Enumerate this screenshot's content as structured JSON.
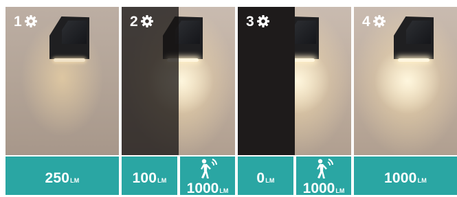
{
  "panels": [
    {
      "number": "1",
      "icon": "gear-icon",
      "mode": "constant dim light"
    },
    {
      "number": "2",
      "icon": "gear-icon",
      "mode": "dim with motion brightening"
    },
    {
      "number": "3",
      "icon": "gear-icon",
      "mode": "off with motion light"
    },
    {
      "number": "4",
      "icon": "gear-icon",
      "mode": "constant bright light"
    }
  ],
  "labels": {
    "l1": {
      "value": "250",
      "unit": "LM"
    },
    "l2a": {
      "value": "100",
      "unit": "LM"
    },
    "l2b": {
      "icon": "motion-sensor-icon",
      "value": "1000",
      "unit": "LM"
    },
    "l3a": {
      "value": "0",
      "unit": "LM"
    },
    "l3b": {
      "icon": "motion-sensor-icon",
      "value": "1000",
      "unit": "LM"
    },
    "l4": {
      "value": "1000",
      "unit": "LM"
    }
  },
  "colors": {
    "accent": "#2aa6a3",
    "text": "#ffffff"
  }
}
